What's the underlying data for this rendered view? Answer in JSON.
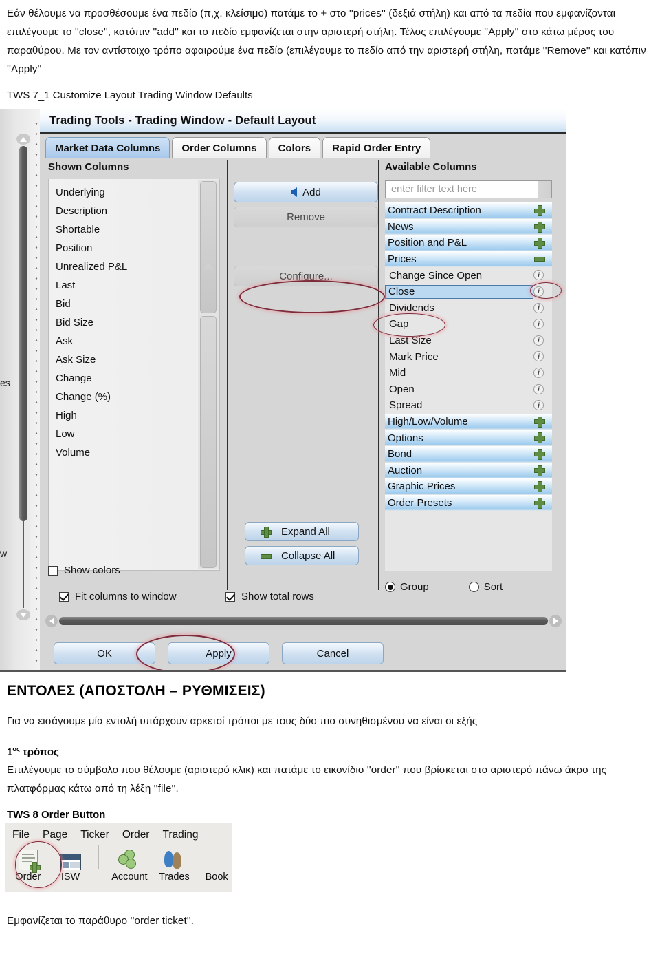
{
  "intro": {
    "paragraph": "Εάν θέλουμε να προσθέσουμε ένα πεδίο (π,χ. κλείσιμο) πατάμε το + στο ''prices'' (δεξιά στήλη) και από τα πεδία που εμφανίζονται επιλέγουμε το ''close'', κατόπιν ''add'' και το πεδίο εμφανίζεται στην αριστερή στήλη. Τέλος επιλέγουμε ''Apply'' στο κάτω μέρος του παραθύρου. Με τον αντίστοιχο τρόπο αφαιρούμε ένα πεδίο (επιλέγουμε το πεδίο από την αριστερή στήλη, πατάμε ''Remove'' και κατόπιν ''Apply''"
  },
  "figure1": {
    "caption": "TWS 7_1 Customize Layout Trading Window Defaults",
    "background_text": {
      "left_upper": "es",
      "left_lower": "w"
    },
    "dialog": {
      "title": "Trading Tools - Trading Window - Default Layout",
      "tabs": [
        {
          "label": "Market Data Columns",
          "active": true
        },
        {
          "label": "Order Columns",
          "active": false
        },
        {
          "label": "Colors",
          "active": false
        },
        {
          "label": "Rapid Order Entry",
          "active": false
        }
      ],
      "shown_columns": {
        "header": "Shown Columns",
        "items": [
          "Underlying",
          "Description",
          "Shortable",
          "Position",
          "Unrealized P&L",
          "Last",
          "Bid",
          "Bid Size",
          "Ask",
          "Ask Size",
          "Change",
          "Change (%)",
          "High",
          "Low",
          "Volume"
        ]
      },
      "center_buttons": {
        "add": "Add",
        "remove": "Remove",
        "configure": "Configure...",
        "expand_all": "Expand All",
        "collapse_all": "Collapse All"
      },
      "available_columns": {
        "header": "Available Columns",
        "filter_placeholder": "enter filter text here",
        "items": [
          {
            "label": "Contract Description",
            "kind": "parent",
            "icon": "plus-icon",
            "selected": false
          },
          {
            "label": "News",
            "kind": "parent",
            "icon": "plus-icon",
            "selected": false
          },
          {
            "label": "Position and P&L",
            "kind": "parent",
            "icon": "plus-icon",
            "selected": false
          },
          {
            "label": "Prices",
            "kind": "parent",
            "icon": "minus-icon",
            "selected": false
          },
          {
            "label": "Change Since Open",
            "kind": "child",
            "icon": "info-icon",
            "selected": false
          },
          {
            "label": "Close",
            "kind": "child",
            "icon": "info-icon",
            "selected": true
          },
          {
            "label": "Dividends",
            "kind": "child",
            "icon": "info-icon",
            "selected": false
          },
          {
            "label": "Gap",
            "kind": "child",
            "icon": "info-icon",
            "selected": false
          },
          {
            "label": "Last Size",
            "kind": "child",
            "icon": "info-icon",
            "selected": false
          },
          {
            "label": "Mark Price",
            "kind": "child",
            "icon": "info-icon",
            "selected": false
          },
          {
            "label": "Mid",
            "kind": "child",
            "icon": "info-icon",
            "selected": false
          },
          {
            "label": "Open",
            "kind": "child",
            "icon": "info-icon",
            "selected": false
          },
          {
            "label": "Spread",
            "kind": "child",
            "icon": "info-icon",
            "selected": false
          },
          {
            "label": "High/Low/Volume",
            "kind": "parent",
            "icon": "plus-icon",
            "selected": false
          },
          {
            "label": "Options",
            "kind": "parent",
            "icon": "plus-icon",
            "selected": false
          },
          {
            "label": "Bond",
            "kind": "parent",
            "icon": "plus-icon",
            "selected": false
          },
          {
            "label": "Auction",
            "kind": "parent",
            "icon": "plus-icon",
            "selected": false
          },
          {
            "label": "Graphic Prices",
            "kind": "parent",
            "icon": "plus-icon",
            "selected": false
          },
          {
            "label": "Order Presets",
            "kind": "parent",
            "icon": "plus-icon",
            "selected": false
          }
        ],
        "radios": [
          {
            "label": "Group",
            "selected": true
          },
          {
            "label": "Sort",
            "selected": false
          }
        ]
      },
      "checkboxes": [
        {
          "label": "Show colors",
          "checked": false
        },
        {
          "label": "Fit columns to window",
          "checked": true
        },
        {
          "label": "Show total rows",
          "checked": true
        }
      ],
      "footer_buttons": [
        {
          "label": "OK",
          "highlighted": false
        },
        {
          "label": "Apply",
          "highlighted": true
        },
        {
          "label": "Cancel",
          "highlighted": false
        }
      ]
    }
  },
  "section": {
    "title": "ΕΝΤΟΛΕΣ (ΑΠΟΣΤΟΛΗ – ΡΥΘΜΙΣΕΙΣ)",
    "intro": "Για να εισάγουμε μία εντολή υπάρχουν αρκετοί τρόποι  με τους δύο πιο συνηθισμένου να είναι οι εξής",
    "way_number": "1",
    "way_sup": "ος",
    "way_label": "τρόπος",
    "way_body": "Επιλέγουμε το σύμβολο που θέλουμε (αριστερό κλικ) και πατάμε το εικονίδιο ''order'' που βρίσκεται στο αριστερό πάνω  άκρο της πλατφόρμας κάτω από τη λέξη ''file''."
  },
  "figure2": {
    "caption": "TWS 8 Order Button",
    "menu": [
      "File",
      "Page",
      "Ticker",
      "Order",
      "Trading"
    ],
    "toolbar": [
      {
        "label": "Order",
        "icon": "new-order-document-icon",
        "highlighted": true
      },
      {
        "label": "ISW",
        "icon": "window-icon",
        "highlighted": false
      },
      {
        "label": "Account",
        "icon": "coins-icon",
        "highlighted": false
      },
      {
        "label": "Trades",
        "icon": "exchange-arrows-icon",
        "highlighted": false
      },
      {
        "label": "Book",
        "icon": "book-icon",
        "highlighted": false
      }
    ]
  },
  "outro": {
    "text": "Εμφανίζεται το παράθυρο ''order ticket''."
  }
}
